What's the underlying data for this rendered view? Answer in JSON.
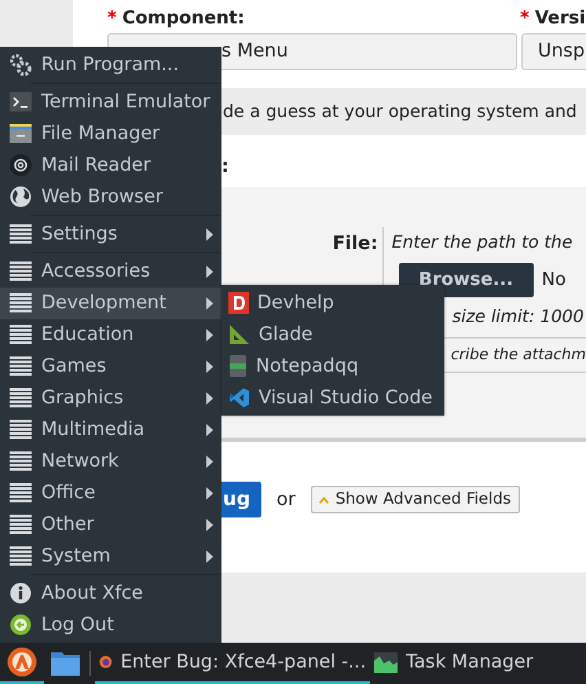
{
  "form": {
    "fields": [
      {
        "mark": "*",
        "label": "Component:",
        "value": "s Menu"
      },
      {
        "mark": "*",
        "label": "Versi",
        "value": "Unsp"
      }
    ],
    "guess_note": "de a guess at your operating system and",
    "section_label": ":",
    "attachment": {
      "file_label": "File:",
      "file_hint": "Enter the path to the",
      "browse_button": "Browse...",
      "file_status": "No",
      "size_note": "size limit: 1000",
      "description_hint": "cribe the attachm"
    },
    "submit_button": "ug",
    "or_text": "or",
    "advanced_button": "Show Advanced Fields"
  },
  "menu": {
    "items": [
      {
        "kind": "app",
        "label": "Run Program..."
      },
      {
        "kind": "separator"
      },
      {
        "kind": "app",
        "label": "Terminal Emulator"
      },
      {
        "kind": "app",
        "label": "File Manager"
      },
      {
        "kind": "app",
        "label": "Mail Reader"
      },
      {
        "kind": "app",
        "label": "Web Browser"
      },
      {
        "kind": "separator"
      },
      {
        "kind": "category",
        "label": "Settings",
        "selected": false
      },
      {
        "kind": "separator"
      },
      {
        "kind": "category",
        "label": "Accessories",
        "selected": false
      },
      {
        "kind": "category",
        "label": "Development",
        "selected": true
      },
      {
        "kind": "category",
        "label": "Education",
        "selected": false
      },
      {
        "kind": "category",
        "label": "Games",
        "selected": false
      },
      {
        "kind": "category",
        "label": "Graphics",
        "selected": false
      },
      {
        "kind": "category",
        "label": "Multimedia",
        "selected": false
      },
      {
        "kind": "category",
        "label": "Network",
        "selected": false
      },
      {
        "kind": "category",
        "label": "Office",
        "selected": false
      },
      {
        "kind": "category",
        "label": "Other",
        "selected": false
      },
      {
        "kind": "category",
        "label": "System",
        "selected": false
      },
      {
        "kind": "separator"
      },
      {
        "kind": "app",
        "label": "About Xfce"
      },
      {
        "kind": "app",
        "label": "Log Out"
      }
    ],
    "submenu": [
      {
        "label": "Devhelp"
      },
      {
        "label": "Glade"
      },
      {
        "label": "Notepadqq"
      },
      {
        "label": "Visual Studio Code"
      }
    ]
  },
  "taskbar": {
    "start_button": {
      "selected": true
    },
    "tasks": [
      {
        "title": "Enter Bug: Xfce4-panel -...",
        "selected": true
      },
      {
        "title": "Task Manager",
        "selected": false
      }
    ]
  }
}
